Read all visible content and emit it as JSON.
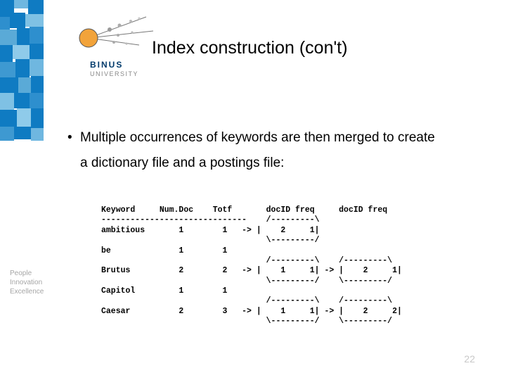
{
  "logo": {
    "name": "BINUS",
    "subtitle": "UNIVERSITY",
    "accent_orange": "#f2a33a",
    "accent_blue": "#0f7bc2",
    "accent_grey": "#b7b7b7"
  },
  "tagline": {
    "line1": "People",
    "line2": "Innovation",
    "line3": "Excellence"
  },
  "slide": {
    "title": "Index construction (con't)",
    "bullet1": "Multiple occurrences of keywords are then merged to create a dictionary file and a postings file:",
    "page_number": "22"
  },
  "dictionary_table": {
    "headers": [
      "Keyword",
      "Num.Doc",
      "Totf"
    ],
    "posting_headers": [
      "docID",
      "freq"
    ],
    "rows": [
      {
        "keyword": "ambitious",
        "numdoc": 1,
        "totf": 1,
        "postings": [
          {
            "docID": 2,
            "freq": 1
          }
        ]
      },
      {
        "keyword": "be",
        "numdoc": 1,
        "totf": 1,
        "postings": []
      },
      {
        "keyword": "Brutus",
        "numdoc": 2,
        "totf": 2,
        "postings": [
          {
            "docID": 1,
            "freq": 1
          },
          {
            "docID": 2,
            "freq": 1
          }
        ]
      },
      {
        "keyword": "Capitol",
        "numdoc": 1,
        "totf": 1,
        "postings": []
      },
      {
        "keyword": "Caesar",
        "numdoc": 2,
        "totf": 3,
        "postings": [
          {
            "docID": 1,
            "freq": 1
          },
          {
            "docID": 2,
            "freq": 2
          }
        ]
      }
    ],
    "ascii": "Keyword     Num.Doc    Totf       docID freq     docID freq\n------------------------------    /---------\\\nambitious       1        1   -> |    2     1|\n                                  \\---------/\nbe              1        1\n                                  /---------\\    /---------\\\nBrutus          2        2   -> |    1     1| -> |    2     1|\n                                  \\---------/    \\---------/\nCapitol         1        1\n                                  /---------\\    /---------\\\nCaesar          2        3   -> |    1     1| -> |    2     2|\n                                  \\---------/    \\---------/"
  }
}
